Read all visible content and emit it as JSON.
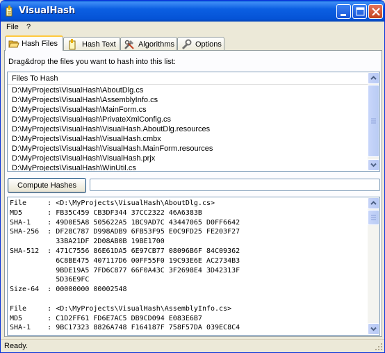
{
  "window": {
    "title": "VisualHash"
  },
  "menu": [
    {
      "label": "File"
    },
    {
      "label": "?"
    }
  ],
  "tabs": [
    {
      "label": "Hash Files",
      "icon": "folder-open-icon",
      "active": true
    },
    {
      "label": "Hash Text",
      "icon": "note-icon",
      "active": false
    },
    {
      "label": "Algorithms",
      "icon": "tools-icon",
      "active": false
    },
    {
      "label": "Options",
      "icon": "wrench-icon",
      "active": false
    }
  ],
  "hash_files": {
    "instruction": "Drag&drop the files you want to hash into this list:",
    "list_header": "Files To Hash",
    "files": [
      "D:\\MyProjects\\VisualHash\\AboutDlg.cs",
      "D:\\MyProjects\\VisualHash\\AssemblyInfo.cs",
      "D:\\MyProjects\\VisualHash\\MainForm.cs",
      "D:\\MyProjects\\VisualHash\\PrivateXmlConfig.cs",
      "D:\\MyProjects\\VisualHash\\VisualHash.AboutDlg.resources",
      "D:\\MyProjects\\VisualHash\\VisualHash.cmbx",
      "D:\\MyProjects\\VisualHash\\VisualHash.MainForm.resources",
      "D:\\MyProjects\\VisualHash\\VisualHash.prjx",
      "D:\\MyProjects\\VisualHash\\WinUtil.cs"
    ],
    "compute_button": "Compute Hashes",
    "progress": 0,
    "output_lines": [
      "File     : <D:\\MyProjects\\VisualHash\\AboutDlg.cs>",
      "MD5      : FB35C459 CB3DF344 37CC2322 46A6383B",
      "SHA-1    : 49D0E5A8 505622A5 1BC9AD7C 43447065 D0FF6642",
      "SHA-256  : DF28C787 D998ADB9 6FB53F95 E0C9FD25 FE203F27",
      "           33BA21DF 2D08AB0B 19BE1700",
      "SHA-512  : 471C7556 86E61DA5 6E97CB77 08096B6F 84C09362",
      "           6C8BE475 407117D6 00FF55F0 19C93E6E AC2734B3",
      "           9BDE19A5 7FD6C877 66F0A43C 3F2698E4 3D42313F",
      "           5D36E9FC",
      "Size-64  : 00000000 00002548",
      "",
      "File     : <D:\\MyProjects\\VisualHash\\AssemblyInfo.cs>",
      "MD5      : C1D2FF61 FD6E7AC5 DB9CD094 E083E6B7",
      "SHA-1    : 9BC17323 8826A748 F164187F 758F57DA 039EC8C4"
    ]
  },
  "status": {
    "text": "Ready."
  },
  "colors": {
    "titlebar": "#0553d6",
    "tab_highlight": "#ffc83c",
    "border": "#7f9db9"
  }
}
